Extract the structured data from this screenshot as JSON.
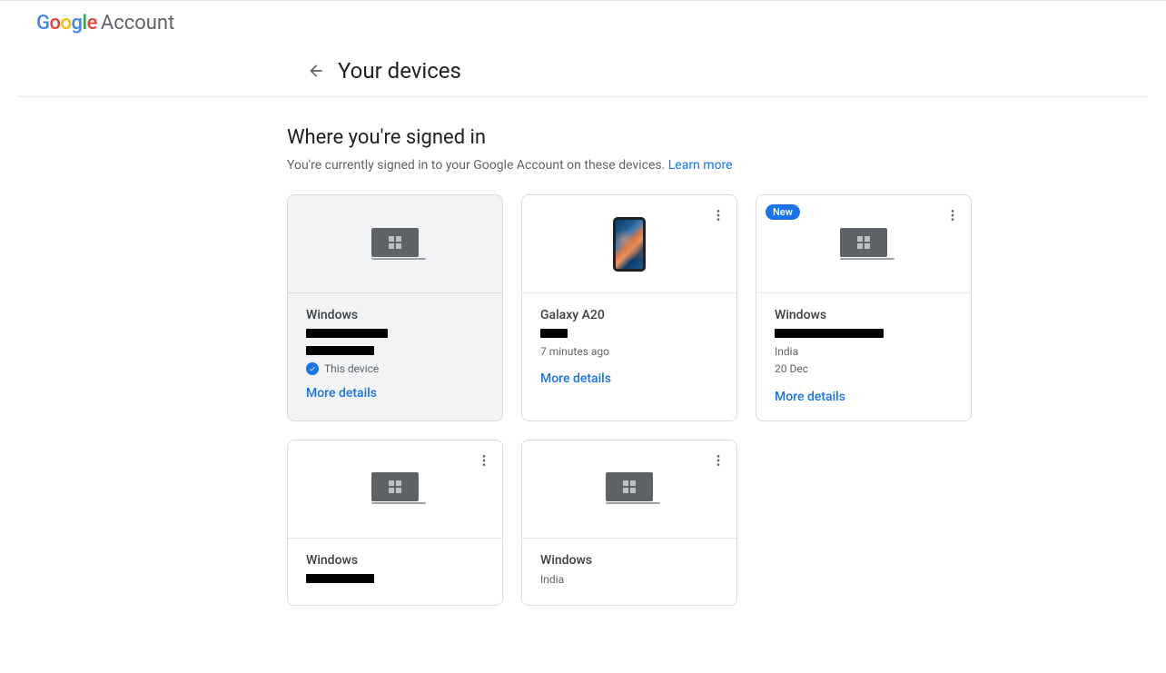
{
  "header": {
    "logo_letters": [
      "G",
      "o",
      "o",
      "g",
      "l",
      "e"
    ],
    "logo_suffix": "Account"
  },
  "page": {
    "title": "Your devices",
    "section_title": "Where you're signed in",
    "section_desc": "You're currently signed in to your Google Account on these devices. ",
    "learn_more": "Learn more"
  },
  "badges": {
    "new": "New"
  },
  "labels": {
    "this_device": "This device",
    "more_details": "More details"
  },
  "devices": [
    {
      "name": "Windows",
      "type": "windows",
      "current": true,
      "meta1_redacted": true,
      "meta2_redacted": true,
      "has_menu": false
    },
    {
      "name": "Galaxy A20",
      "type": "phone",
      "meta1_redacted": true,
      "meta2": "7 minutes ago",
      "has_menu": true
    },
    {
      "name": "Windows",
      "type": "windows",
      "badge": "new",
      "meta1_redacted": true,
      "meta2": "India",
      "meta3": "20 Dec",
      "has_menu": true
    },
    {
      "name": "Windows",
      "type": "windows",
      "meta1_redacted": true,
      "has_menu": true
    },
    {
      "name": "Windows",
      "type": "windows",
      "meta2": "India",
      "has_menu": true
    }
  ]
}
